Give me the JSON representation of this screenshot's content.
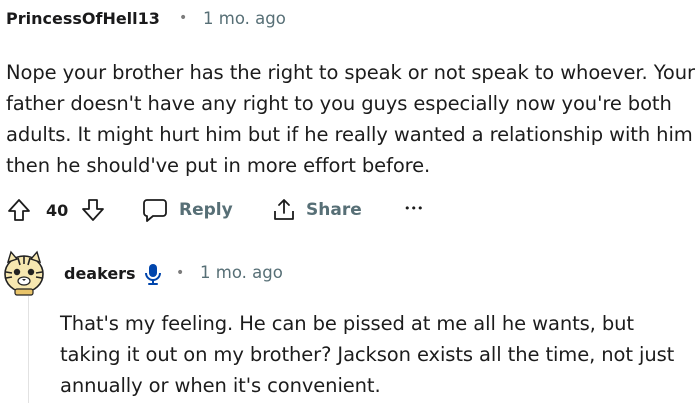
{
  "comments": [
    {
      "author": "PrincessOfHell13",
      "separator": "•",
      "time": "1 mo. ago",
      "text": "Nope your brother has the right to speak or not speak to whoever. Your father doesn't have any right to you guys especially now you're both adults. It might hurt him but if he really wanted a relationship with him then he should've put in more effort before.",
      "votes": "40",
      "reply_label": "Reply",
      "share_label": "Share",
      "more_label": "•••",
      "icons": [
        "upvote-icon",
        "downvote-icon",
        "comment-bubble-icon",
        "share-icon",
        "more-options-icon"
      ]
    },
    {
      "author": "deakers",
      "separator": "•",
      "time": "1 mo. ago",
      "text": "That's my feeling. He can be pissed at me all he wants, but taking it out on my brother? Jackson exists all the time, not just annually or when it's convenient.",
      "icons": [
        "tiger-avatar",
        "microphone-icon"
      ]
    }
  ],
  "colors": {
    "meta": "#576f76",
    "accent_blue": "#0045ac",
    "text": "#1c1c1c",
    "thread": "#e2e2e2"
  }
}
